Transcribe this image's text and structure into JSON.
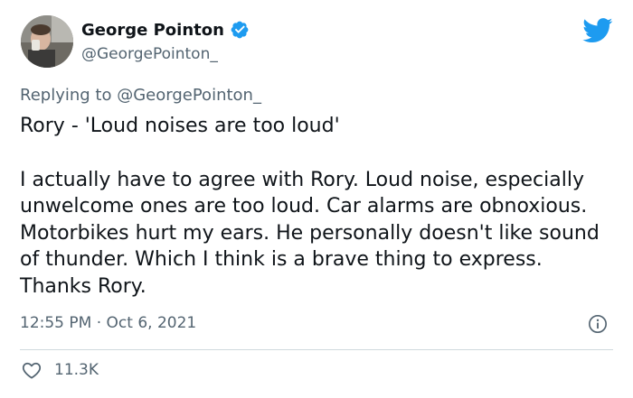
{
  "author": {
    "name": "George Pointon",
    "handle": "@GeorgePointon_",
    "verified_icon": "verified-badge-icon"
  },
  "platform_icon": "twitter-bird-icon",
  "reply": {
    "prefix": "Replying to",
    "target": "@GeorgePointon_"
  },
  "tweet": {
    "line1": "Rory - 'Loud noises are too loud'",
    "line2": "I actually have to agree with Rory. Loud noise, especially unwelcome ones are too loud. Car alarms are obnoxious. Motorbikes hurt my ears. He personally doesn't like sound of thunder. Which I think is a brave thing to express. Thanks Rory."
  },
  "timestamp": "12:55 PM · Oct 6, 2021",
  "likes": "11.3K",
  "colors": {
    "accent": "#1d9bf0",
    "text": "#0f1419",
    "muted": "#536471",
    "divider": "#cfd9de"
  }
}
